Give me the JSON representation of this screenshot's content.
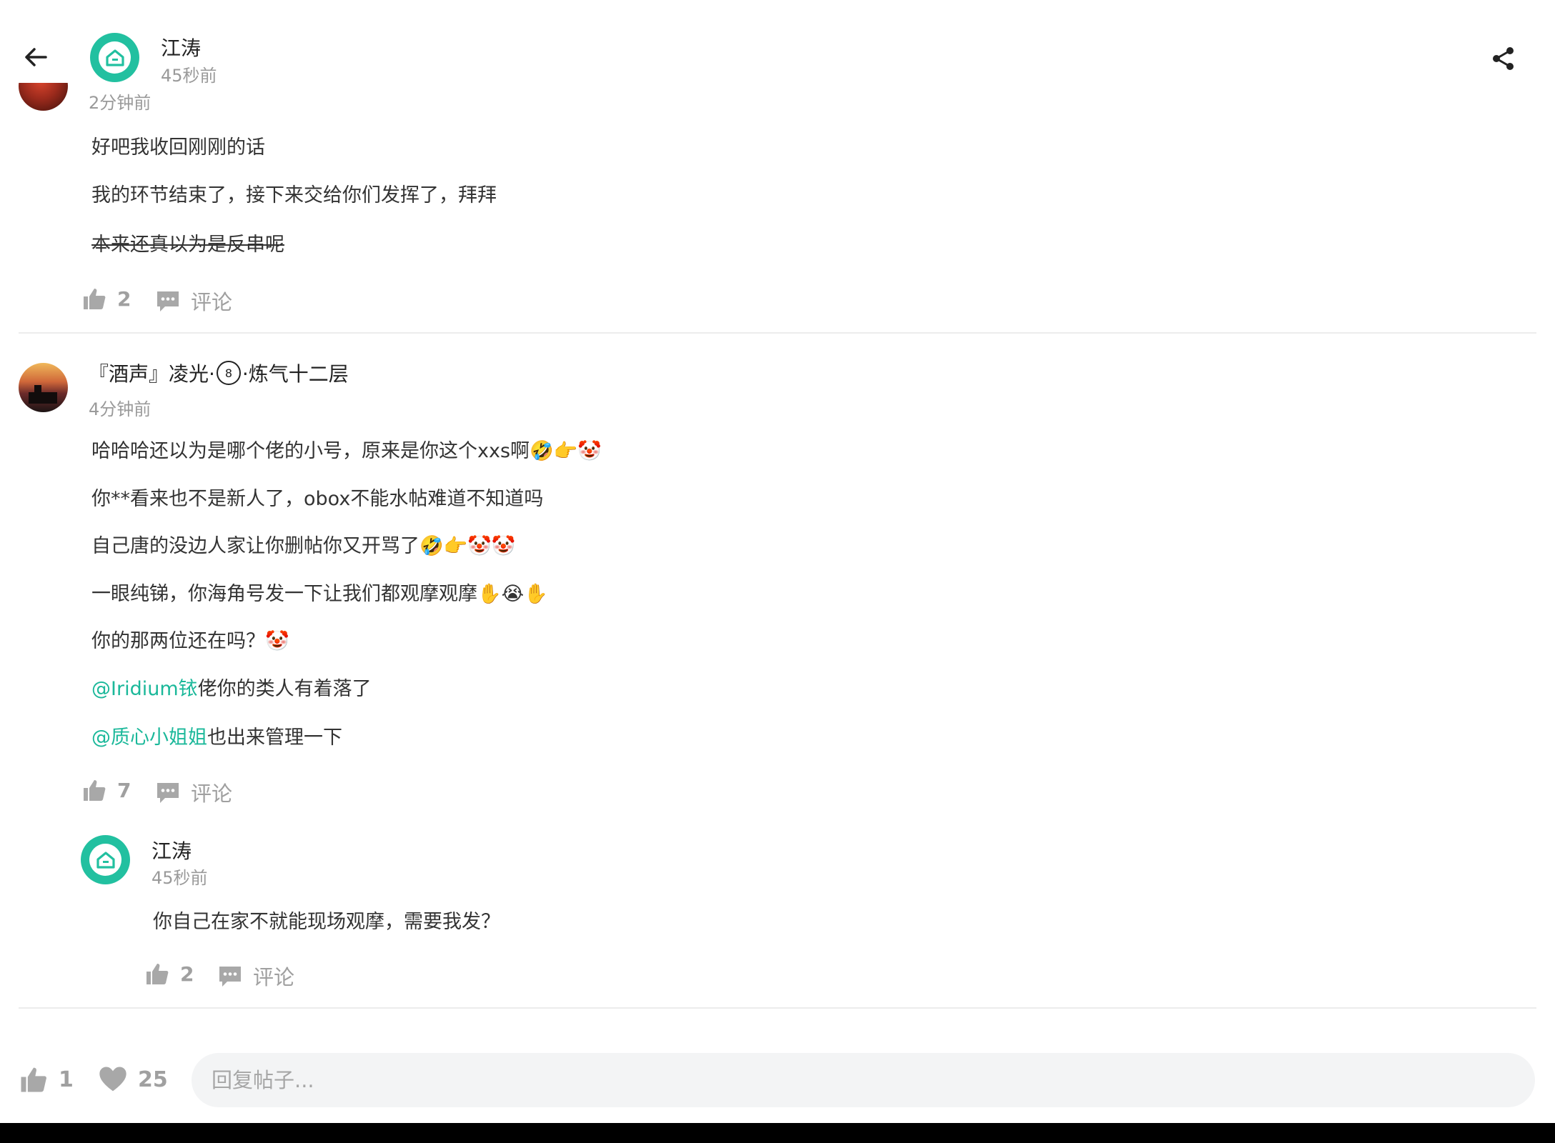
{
  "header": {
    "author": "江涛",
    "time": "45秒前"
  },
  "comments": [
    {
      "time": "2分钟前",
      "lines": [
        "好吧我收回刚刚的话",
        "我的环节结束了，接下来交给你们发挥了，拜拜"
      ],
      "strike_line": " 本来还真以为是反串呢 ",
      "likes": "2",
      "comment_label": "评论"
    },
    {
      "name_prefix": "『酒声』凌光·",
      "name_badge": "8",
      "name_suffix": "·炼气十二层",
      "time": "4分钟前",
      "lines": [
        "哈哈哈还以为是哪个佬的小号，原来是你这个xxs啊🤣👉🤡",
        "你**看来也不是新人了，obox不能水帖难道不知道吗",
        "自己唐的没边人家让你删帖你又开骂了🤣👉🤡🤡",
        "一眼纯锑，你海角号发一下让我们都观摩观摩✋😭✋",
        "你的那两位还在吗？🤡"
      ],
      "mention1": "@Iridium铱",
      "mention1_rest": "佬你的类人有着落了",
      "mention2": "@质心小姐姐",
      "mention2_rest": "也出来管理一下",
      "likes": "7",
      "comment_label": "评论",
      "reply": {
        "name": "江涛",
        "time": "45秒前",
        "text": "你自己在家不就能现场观摩，需要我发？",
        "likes": "2",
        "comment_label": "评论"
      }
    }
  ],
  "footer": {
    "likes": "1",
    "favorites": "25",
    "reply_placeholder": "回复帖子..."
  },
  "colors": {
    "accent": "#22c0a0",
    "mention": "#1bb89a",
    "muted": "#a0a0a0"
  },
  "icons": [
    "back-arrow-icon",
    "share-icon",
    "thumbs-up-icon",
    "comment-bubble-icon",
    "heart-icon",
    "home-logo-icon"
  ]
}
